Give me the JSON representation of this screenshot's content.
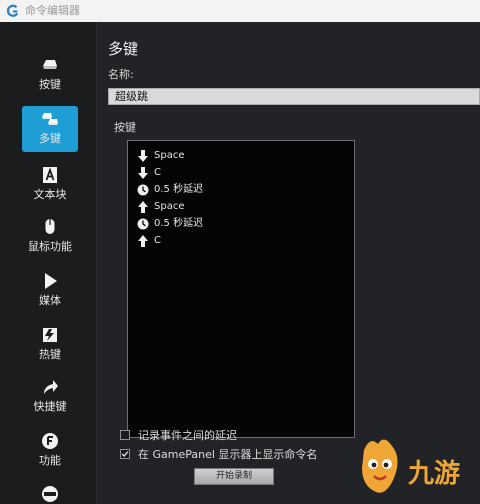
{
  "window": {
    "title": "命令编辑器"
  },
  "sidebar": {
    "items": [
      {
        "label": "按键",
        "icon": "keycap-icon",
        "active": false
      },
      {
        "label": "多键",
        "icon": "multi-key-icon",
        "active": true
      },
      {
        "label": "文本块",
        "icon": "text-block-icon",
        "active": false
      },
      {
        "label": "鼠标功能",
        "icon": "mouse-icon",
        "active": false
      },
      {
        "label": "媒体",
        "icon": "play-icon",
        "active": false
      },
      {
        "label": "热键",
        "icon": "hotkey-icon",
        "active": false
      },
      {
        "label": "快捷键",
        "icon": "shortcut-arrow-icon",
        "active": false
      },
      {
        "label": "功能",
        "icon": "function-gear-icon",
        "active": false
      }
    ]
  },
  "main": {
    "title": "多键",
    "name_label": "名称:",
    "name_value": "超级跳",
    "keys_label": "按键",
    "macro_steps": [
      {
        "type": "keydown",
        "text": "Space",
        "icon": "arrow-down-icon"
      },
      {
        "type": "keydown",
        "text": "C",
        "icon": "arrow-down-icon"
      },
      {
        "type": "delay",
        "text": "0.5 秒延迟",
        "icon": "clock-icon"
      },
      {
        "type": "keyup",
        "text": "Space",
        "icon": "arrow-up-icon"
      },
      {
        "type": "delay",
        "text": "0.5 秒延迟",
        "icon": "clock-icon"
      },
      {
        "type": "keyup",
        "text": "C",
        "icon": "arrow-up-icon"
      }
    ],
    "options": [
      {
        "label": "记录事件之间的延迟",
        "checked": false
      },
      {
        "label": "在 GamePanel 显示器上显示命令名",
        "checked": true
      }
    ],
    "record_button": "开始录制"
  },
  "watermark": {
    "text": "九游"
  },
  "colors": {
    "accent": "#1f9ed6",
    "background": "#212326",
    "watermark": "#f0a637"
  }
}
